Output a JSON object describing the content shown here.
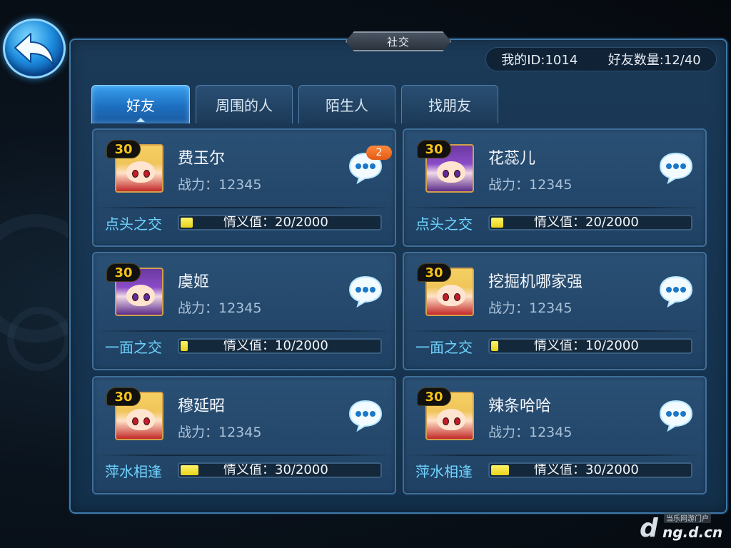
{
  "window": {
    "title": "社交"
  },
  "header": {
    "my_id": "我的ID:1014",
    "friend_count": "好友数量:12/40"
  },
  "tabs": [
    {
      "label": "好友",
      "active": true
    },
    {
      "label": "周围的人",
      "active": false
    },
    {
      "label": "陌生人",
      "active": false
    },
    {
      "label": "找朋友",
      "active": false
    }
  ],
  "friends": [
    {
      "level": "30",
      "name": "费玉尔",
      "power": "战力：12345",
      "relation": "点头之交",
      "intimacy": "情义值：20/2000",
      "intimacy_value": 20,
      "intimacy_max": 2000,
      "unread": "2",
      "avatar": "blonde",
      "icon": "chat-bubble-icon"
    },
    {
      "level": "30",
      "name": "花蕊儿",
      "power": "战力：12345",
      "relation": "点头之交",
      "intimacy": "情义值：20/2000",
      "intimacy_value": 20,
      "intimacy_max": 2000,
      "unread": "",
      "avatar": "purple",
      "icon": "chat-bubble-icon"
    },
    {
      "level": "30",
      "name": "虞姬",
      "power": "战力：12345",
      "relation": "一面之交",
      "intimacy": "情义值：10/2000",
      "intimacy_value": 10,
      "intimacy_max": 2000,
      "unread": "",
      "avatar": "purple",
      "icon": "chat-bubble-icon"
    },
    {
      "level": "30",
      "name": "挖掘机哪家强",
      "power": "战力：12345",
      "relation": "一面之交",
      "intimacy": "情义值：10/2000",
      "intimacy_value": 10,
      "intimacy_max": 2000,
      "unread": "",
      "avatar": "blonde",
      "icon": "chat-bubble-icon"
    },
    {
      "level": "30",
      "name": "穆延昭",
      "power": "战力：12345",
      "relation": "萍水相逢",
      "intimacy": "情义值：30/2000",
      "intimacy_value": 30,
      "intimacy_max": 2000,
      "unread": "",
      "avatar": "blonde",
      "icon": "chat-bubble-icon"
    },
    {
      "level": "30",
      "name": "辣条哈哈",
      "power": "战力：12345",
      "relation": "萍水相逢",
      "intimacy": "情义值：30/2000",
      "intimacy_value": 30,
      "intimacy_max": 2000,
      "unread": "",
      "avatar": "blonde",
      "icon": "chat-bubble-icon"
    }
  ],
  "watermark": {
    "top": "当乐网游门户",
    "main": "ng.d.cn",
    "letter": "d"
  },
  "colors": {
    "accent": "#1d6fc0",
    "relation_text": "#6fd3ff",
    "level_text": "#f5c21a",
    "bar_fill": "#e8d21a",
    "badge": "#e45a16"
  },
  "icons": {
    "back": "back-arrow-icon",
    "chat": "chat-bubble-icon"
  }
}
